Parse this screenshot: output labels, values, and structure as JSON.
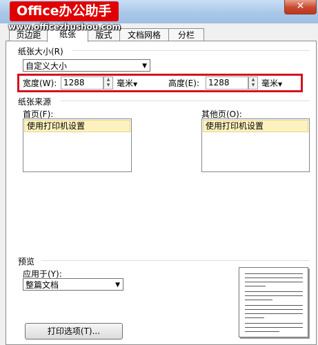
{
  "brand": {
    "logo_text": "Office办公助手",
    "watermark": "www.officezhushou.com"
  },
  "window": {
    "close_glyph": "✕"
  },
  "tabs": [
    {
      "label": "页边距"
    },
    {
      "label": "纸张"
    },
    {
      "label": "版式"
    },
    {
      "label": "文档网格"
    },
    {
      "label": "分栏"
    }
  ],
  "paper_size": {
    "section_label": "纸张大小(R)",
    "selected": "自定义大小",
    "width_label": "宽度(W):",
    "width_value": "1288",
    "width_unit": "毫米",
    "height_label": "高度(E):",
    "height_value": "1288",
    "height_unit": "毫米"
  },
  "paper_source": {
    "section_label": "纸张来源",
    "first_page_label": "首页(F):",
    "first_page_item": "使用打印机设置",
    "other_pages_label": "其他页(O):",
    "other_pages_item": "使用打印机设置"
  },
  "preview": {
    "section_label": "预览",
    "apply_to_label": "应用于(Y):",
    "apply_to_value": "整篇文档"
  },
  "print_options_button": "打印选项(T)..."
}
